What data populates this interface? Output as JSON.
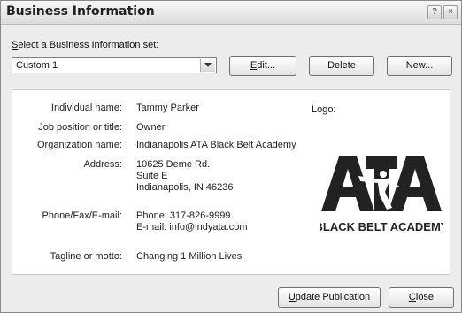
{
  "window": {
    "title": "Business Information"
  },
  "selector": {
    "label_pre": "",
    "label_key": "S",
    "label_post": "elect a Business Information set:",
    "selected_value": "Custom 1",
    "edit_key": "E",
    "edit_rest": "dit...",
    "delete_label": "Delete",
    "new_label": "New..."
  },
  "info": {
    "individual_label": "Individual name:",
    "individual_value": "Tammy Parker",
    "job_label": "Job position or title:",
    "job_value": "Owner",
    "org_label": "Organization name:",
    "org_value": "Indianapolis ATA Black Belt Academy",
    "address_label": "Address:",
    "address_line1": "10625 Deme Rd.",
    "address_line2": "Suite E",
    "address_line3": "Indianapolis, IN 46236",
    "phone_label": "Phone/Fax/E-mail:",
    "phone_value": "Phone: 317-826-9999",
    "email_value": "E-mail: info@indyata.com",
    "tagline_label": "Tagline or motto:",
    "tagline_value": "Changing 1 Million Lives",
    "logo_label": "Logo:"
  },
  "logo": {
    "mark": "ATA",
    "caption": "BLACK BELT ACADEMY"
  },
  "footer": {
    "update_key": "U",
    "update_rest": "pdate Publication",
    "close_key": "C",
    "close_rest": "lose"
  },
  "titlebar_buttons": {
    "help": "?",
    "close": "×"
  }
}
